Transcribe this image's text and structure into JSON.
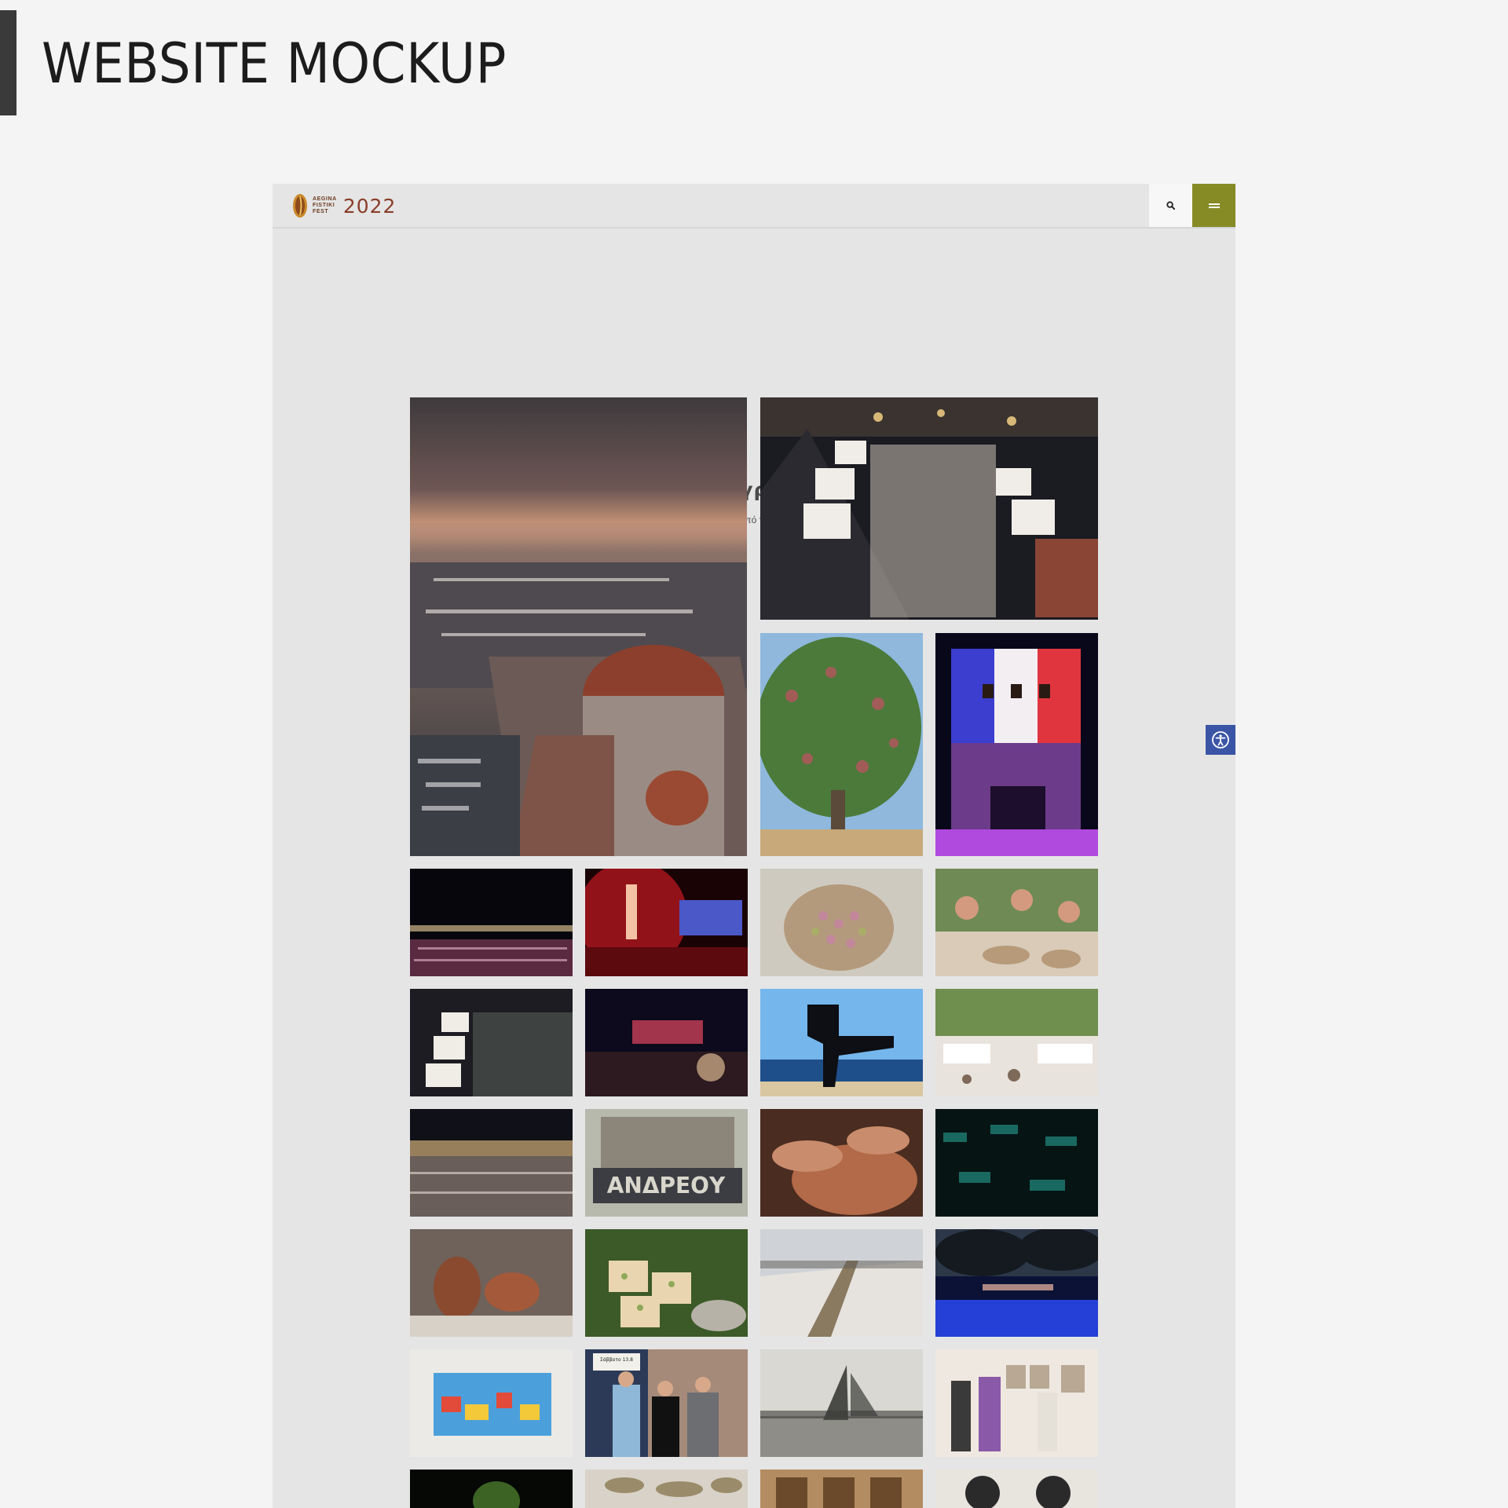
{
  "header": {
    "title": "WEBSITE MOCKUP"
  },
  "site": {
    "logo": {
      "line1": "AEGINA",
      "line2": "FISTIKI",
      "line3": "FEST",
      "year": "2022"
    },
    "nav": {
      "search_icon": "search-icon",
      "menu_icon": "menu-icon"
    },
    "heading": "Φωτογραφίες",
    "subheading": "Δείτε φωτογραφικό υλικό από το Fistiki Fest & το νησί μας",
    "accessibility_icon": "accessibility-icon",
    "colors": {
      "accent": "#868b26",
      "logo": "#8a3d2a",
      "accessibility": "#3b55a6"
    },
    "gallery": [
      {
        "name": "harbor-sunset-church",
        "sign": ""
      },
      {
        "name": "night-market-crowd",
        "sign": ""
      },
      {
        "name": "pistachio-tree",
        "sign": ""
      },
      {
        "name": "tower-flag-concert",
        "sign": ""
      },
      {
        "name": "night-harbor-crowd",
        "sign": ""
      },
      {
        "name": "red-stage-performer",
        "sign": ""
      },
      {
        "name": "pistachio-sack",
        "sign": ""
      },
      {
        "name": "children-crafting",
        "sign": ""
      },
      {
        "name": "market-stalls-night",
        "sign": ""
      },
      {
        "name": "concert-audience",
        "sign": ""
      },
      {
        "name": "seaside-sculpture",
        "sign": ""
      },
      {
        "name": "kids-dance-event",
        "sign": ""
      },
      {
        "name": "waterfront-crowd",
        "sign": ""
      },
      {
        "name": "andreou-sign",
        "sign": "ΑΝΔΡΕΟΥ"
      },
      {
        "name": "pottery-wheel",
        "sign": ""
      },
      {
        "name": "green-light-show",
        "sign": ""
      },
      {
        "name": "ancient-pottery",
        "sign": ""
      },
      {
        "name": "pistachio-sweets",
        "sign": ""
      },
      {
        "name": "long-table-pier",
        "sign": ""
      },
      {
        "name": "blue-lit-trees",
        "sign": ""
      },
      {
        "name": "colorful-painting",
        "sign": ""
      },
      {
        "name": "group-poster-photo",
        "sign": "Σάββατο 13.8"
      },
      {
        "name": "vintage-harbor-photo",
        "sign": ""
      },
      {
        "name": "exhibition-visitors",
        "sign": ""
      },
      {
        "name": "night-stage-green",
        "sign": ""
      },
      {
        "name": "food-table",
        "sign": ""
      },
      {
        "name": "wooden-doors",
        "sign": ""
      },
      {
        "name": "indoor-workshop",
        "sign": ""
      }
    ]
  }
}
